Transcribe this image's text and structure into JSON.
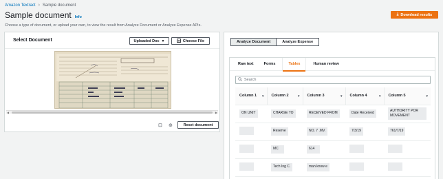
{
  "breadcrumb": {
    "root": "Amazon Textract",
    "current": "Sample document"
  },
  "header": {
    "title": "Sample document",
    "info": "Info",
    "download_label": "Download results"
  },
  "description": "Choose a type of document, or upload your own, to view the result from Analyze Document or Analyze Expense APIs.",
  "left_panel": {
    "title": "Select Document",
    "uploaded_label": "Uploaded Doc",
    "choose_label": "Choose File",
    "reset_label": "Reset document"
  },
  "right_panel": {
    "segments": [
      "Analyze Document",
      "Analyze Expense"
    ],
    "tabs": [
      "Raw text",
      "Forms",
      "Tables",
      "Human review"
    ],
    "active_tab": "Tables",
    "search_placeholder": "Search",
    "columns": [
      "Column 1",
      "Column 2",
      "Column 3",
      "Column 4",
      "Column 5"
    ],
    "rows": [
      [
        "ON UNIT",
        "CHARGE TO",
        "RECEIVED FROM",
        "Date Received",
        "AUTHORITY POR MOVEMENT"
      ],
      [
        "",
        "Reserve",
        "NO. 7 .MV.",
        "7/3/19",
        "761/7/19"
      ],
      [
        "",
        "MC",
        "614",
        "",
        ""
      ],
      [
        "",
        "Tech Ing C.",
        "man know e",
        "",
        ""
      ]
    ]
  },
  "colors": {
    "accent": "#ec7211",
    "link": "#0073bb"
  }
}
